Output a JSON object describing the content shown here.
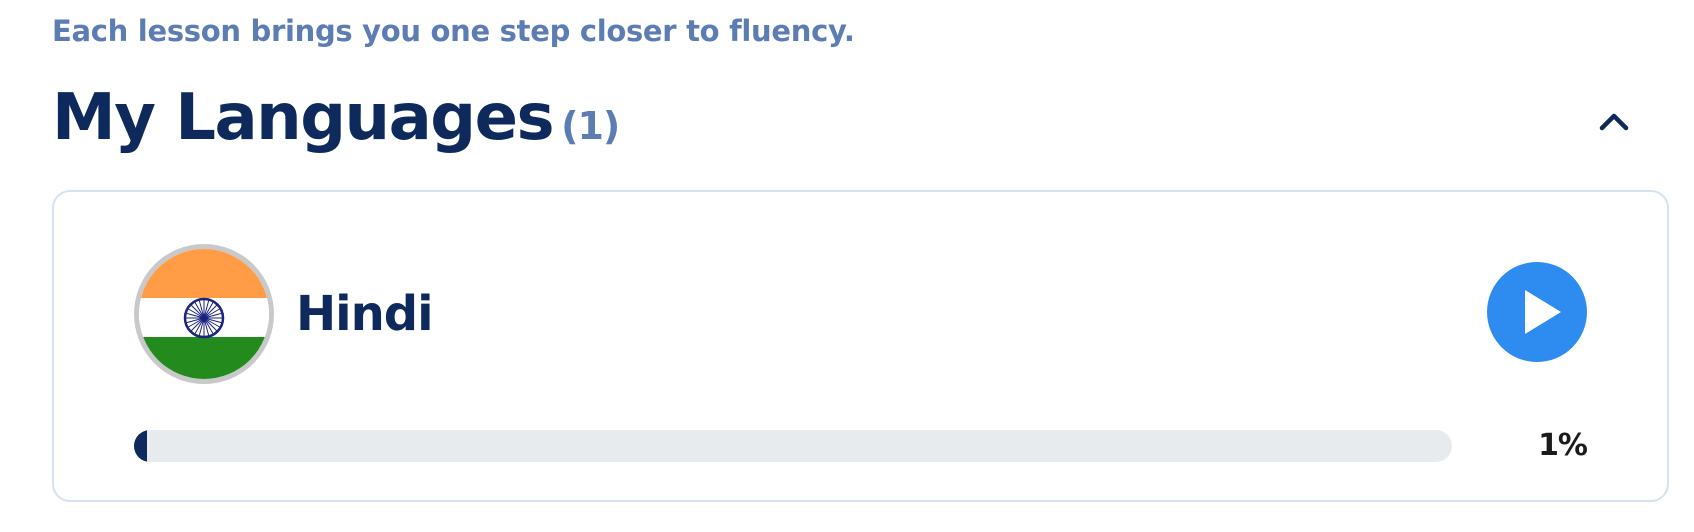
{
  "header": {
    "subtitle": "Each lesson brings you one step closer to fluency."
  },
  "section": {
    "title": "My Languages",
    "count": "(1)",
    "collapse_icon": "chevron-up-icon"
  },
  "languages": [
    {
      "name": "Hindi",
      "flag_icon": "india-flag-icon",
      "play_icon": "play-icon",
      "progress_fraction": 0.01,
      "progress_label": "1%"
    }
  ],
  "colors": {
    "heading": "#0e2a5c",
    "muted_blue": "#5b7db3",
    "play_button": "#2e8cf0",
    "progress_track": "#e8ebee",
    "progress_fill": "#0e2a5c",
    "card_border": "#d6e2f0"
  }
}
